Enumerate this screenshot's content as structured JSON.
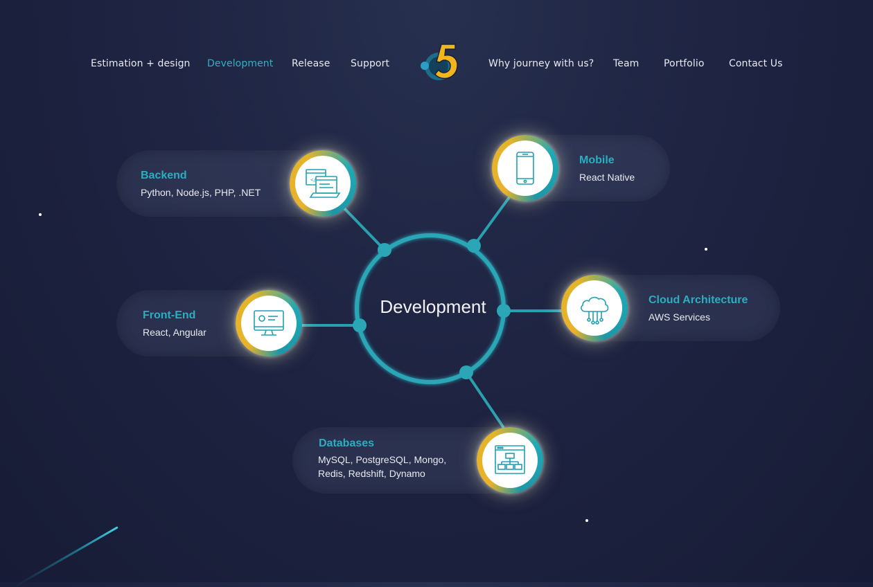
{
  "nav": {
    "left": [
      {
        "label": "Estimation + design",
        "active": false
      },
      {
        "label": "Development",
        "active": true
      },
      {
        "label": "Release",
        "active": false
      },
      {
        "label": "Support",
        "active": false
      }
    ],
    "right": [
      {
        "label": "Why journey with us?"
      },
      {
        "label": "Team"
      },
      {
        "label": "Portfolio"
      },
      {
        "label": "Contact Us"
      }
    ],
    "logo_icon": "five-logo-icon"
  },
  "center": {
    "label": "Development"
  },
  "cards": {
    "backend": {
      "title": "Backend",
      "text": "Python, Node.js, PHP, .NET",
      "icon": "code-window-icon"
    },
    "mobile": {
      "title": "Mobile",
      "text": "React Native",
      "icon": "smartphone-icon"
    },
    "frontend": {
      "title": "Front-End",
      "text": "React, Angular",
      "icon": "desktop-monitor-icon"
    },
    "cloud": {
      "title": "Cloud Architecture",
      "text": "AWS Services",
      "icon": "cloud-network-icon"
    },
    "databases": {
      "title": "Databases",
      "text_line1": "MySQL, PostgreSQL, Mongo,",
      "text_line2": "Redis, Redshift, Dynamo",
      "icon": "database-schema-icon"
    }
  },
  "colors": {
    "accent": "#2aaec0",
    "ring_gold": "#e8b22c",
    "background": "#1e2442"
  }
}
